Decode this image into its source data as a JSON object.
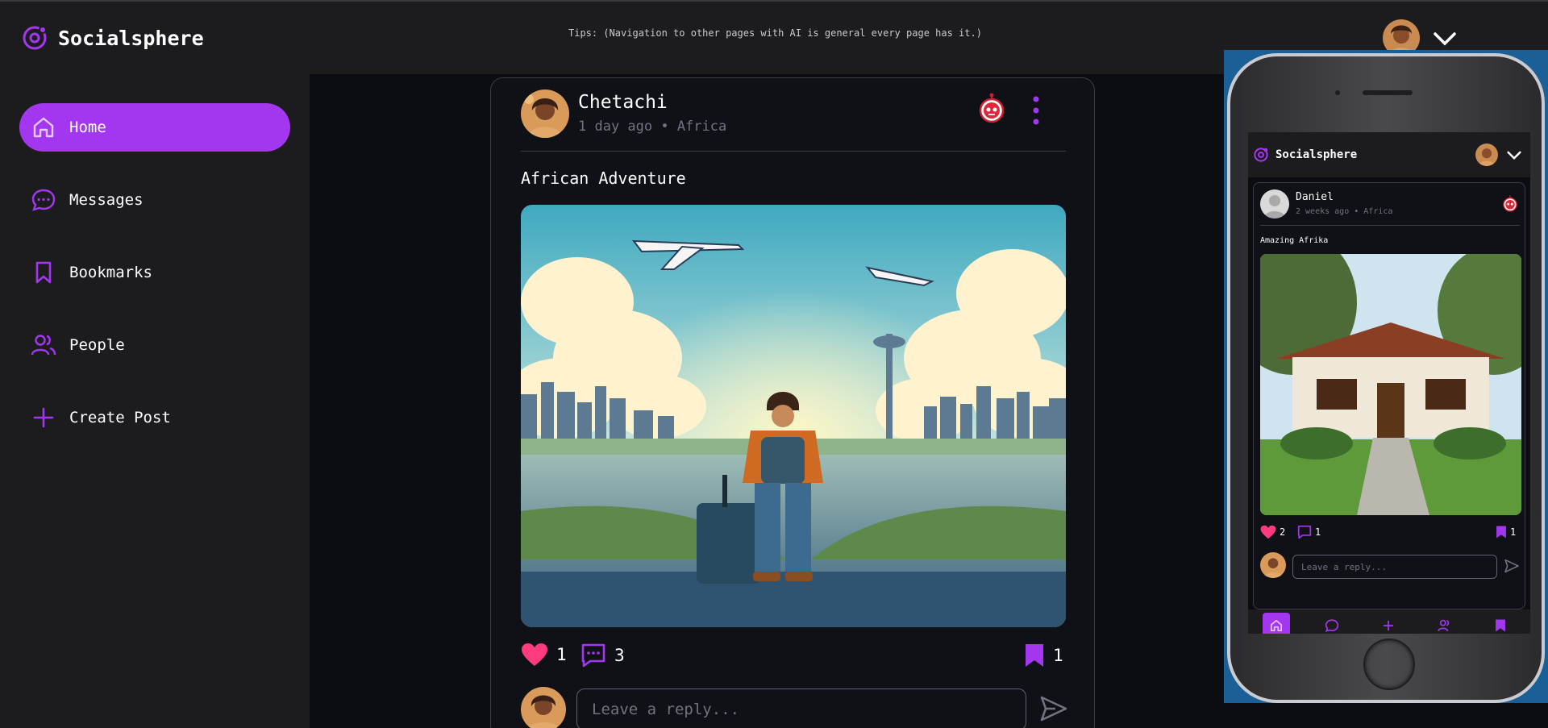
{
  "app": {
    "name": "Socialsphere"
  },
  "header": {
    "tips": "Tips: (Navigation to other pages with AI is general every page has it.)"
  },
  "sidebar": {
    "items": [
      {
        "label": "Home",
        "icon": "home-icon",
        "active": true
      },
      {
        "label": "Messages",
        "icon": "message-icon",
        "active": false
      },
      {
        "label": "Bookmarks",
        "icon": "bookmark-icon",
        "active": false
      },
      {
        "label": "People",
        "icon": "people-icon",
        "active": false
      },
      {
        "label": "Create Post",
        "icon": "plus-icon",
        "active": false
      }
    ]
  },
  "post": {
    "author": "Chetachi",
    "meta": "1 day ago • Africa",
    "title": "African Adventure",
    "likes": "1",
    "comments": "3",
    "bookmarks": "1",
    "reply_placeholder": "Leave a reply..."
  },
  "phone": {
    "brand": "Socialsphere",
    "post": {
      "author": "Daniel",
      "meta": "2 weeks ago • Africa",
      "title": "Amazing Afrika",
      "likes": "2",
      "comments": "1",
      "bookmarks": "1",
      "reply_placeholder": "Leave a reply..."
    },
    "bottom_nav": [
      "home-icon",
      "message-icon",
      "plus-icon",
      "people-icon",
      "bookmark-icon"
    ]
  },
  "colors": {
    "accent": "#a337f0",
    "like": "#ff3b7f",
    "sidebar_bg": "#1c1c1f",
    "feed_bg": "#0b0d12"
  }
}
